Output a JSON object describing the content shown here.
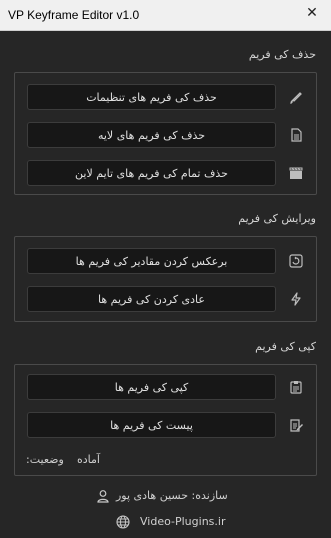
{
  "window": {
    "title": "VP Keyframe Editor v1.0",
    "close_glyph": "✕"
  },
  "sections": {
    "delete": {
      "title": "حذف کی فریم",
      "buttons": [
        {
          "label": "حذف کی فریم های تنظیمات",
          "icon": "brush-icon"
        },
        {
          "label": "حذف کی فریم های لایه",
          "icon": "document-icon"
        },
        {
          "label": "حذف تمام کی فریم های تایم لاین",
          "icon": "clapperboard-icon"
        }
      ]
    },
    "edit": {
      "title": "ویرایش کی فریم",
      "buttons": [
        {
          "label": "برعکس کردن مقادیر کی فریم ها",
          "icon": "reverse-icon"
        },
        {
          "label": "عادی کردن کی فریم ها",
          "icon": "lightning-icon"
        }
      ]
    },
    "copy": {
      "title": "کپی کی فریم",
      "buttons": [
        {
          "label": "کپی کی فریم ها",
          "icon": "clipboard-icon"
        },
        {
          "label": "پیست کی فریم ها",
          "icon": "paste-icon"
        }
      ]
    }
  },
  "status": {
    "label": "وضعیت:",
    "value": "آماده"
  },
  "footer": {
    "author": "سازنده: حسین هادی پور",
    "website": "Video-Plugins.ir"
  },
  "colors": {
    "background": "#262626",
    "button_bg": "#171717",
    "panel_border": "#4a4a4a",
    "text": "#e0e0e0"
  }
}
